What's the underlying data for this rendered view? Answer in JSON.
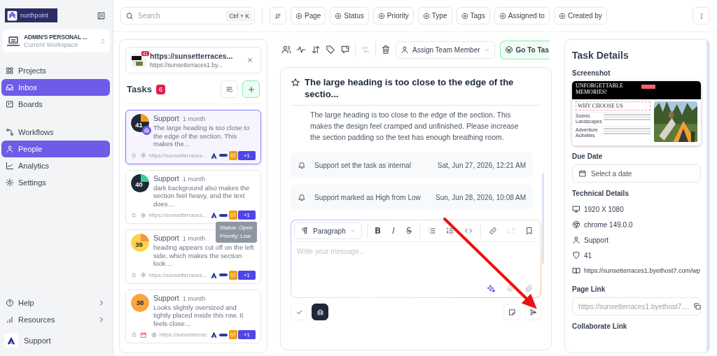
{
  "sidebar": {
    "logo_text": "northpoint",
    "workspace": {
      "name": "ADMIN'S PERSONAL ...",
      "subtitle": "Current Workspace"
    },
    "nav": [
      {
        "items": [
          {
            "label": "Projects",
            "selected": false
          },
          {
            "label": "Inbox",
            "selected": true
          },
          {
            "label": "Boards",
            "selected": false
          }
        ]
      },
      {
        "items": [
          {
            "label": "Workflows",
            "selected": false
          },
          {
            "label": "People",
            "selected": true
          },
          {
            "label": "Analytics",
            "selected": false
          },
          {
            "label": "Settings",
            "selected": false
          }
        ]
      }
    ],
    "footer_links": [
      "Help",
      "Resources"
    ],
    "user": "Support"
  },
  "topbar": {
    "search": {
      "placeholder": "Search",
      "shortcut": "Ctrl + K"
    },
    "filters": [
      "Page",
      "Status",
      "Priority",
      "Type",
      "Tags",
      "Assigned to",
      "Created by"
    ]
  },
  "tasks_panel": {
    "site": {
      "badge": "41",
      "title": "https://sunsetterraces...",
      "url": "https://sunsetterraces1.by..."
    },
    "title": "Tasks",
    "count": "6",
    "tasks": [
      {
        "author": "Support",
        "age": "1 month",
        "number": "41",
        "color": "#1f2937",
        "ring": {
          "color": "#f59e0b"
        },
        "internal": true,
        "has_due_date": false,
        "selected": true,
        "description": "The large heading is too close to the edge of the section. This makes the…",
        "url": "https://sunsetterraces...",
        "avatars": [
          "ST",
          "+1"
        ]
      },
      {
        "author": "Support",
        "age": "1 month",
        "number": "40",
        "color": "#1f2937",
        "ring": {
          "color": "#34d399"
        },
        "internal": false,
        "has_due_date": false,
        "selected": false,
        "description": "dark background also makes the section feel heavy, and the text does…",
        "url": "https://sunsetterraces...",
        "avatars": [
          "ST",
          "+1"
        ]
      },
      {
        "author": "Support",
        "age": "1 month",
        "number": "39",
        "color": "#fcd34d",
        "ring": {
          "color": "#fb923c"
        },
        "internal": false,
        "has_due_date": false,
        "selected": false,
        "description": "heading appears cut off on the left side, which makes the section look…",
        "url": "https://sunsetterraces...",
        "avatars": [
          "ST",
          "+1"
        ],
        "tooltip": [
          "Status: Open",
          "Priority: Low"
        ]
      },
      {
        "author": "Support",
        "age": "1 month",
        "number": "38",
        "color": "#fba43c",
        "internal": false,
        "has_due_date": true,
        "selected": false,
        "description": "Looks slightly oversized and tightly placed inside this row. It feels close…",
        "url": "https://sunsetterrac",
        "avatars": [
          "ST",
          "+1"
        ]
      }
    ]
  },
  "detail": {
    "actions": [
      {
        "disabled": false
      },
      {
        "disabled": false
      },
      {
        "disabled": false
      },
      {
        "disabled": false
      },
      {
        "disabled": false
      },
      {
        "disabled": true
      },
      {
        "disabled": false
      }
    ],
    "assign_label": "Assign Team Member",
    "goto_label": "Go To Tas",
    "title": "The large heading is too close to the edge of the sectio...",
    "body": "The large heading is too close to the edge of the section. This makes the design feel cramped and unfinished. Please increase the section padding so the text has enough breathing room.",
    "activity": [
      {
        "text": "Support set the task as internal",
        "date": "Sat, Jun 27, 2026, 12:21 AM"
      },
      {
        "text": "Support marked as High from Low",
        "date": "Sun, Jun 28, 2026, 10:08 AM"
      }
    ],
    "editor": {
      "format": "Paragraph",
      "format_buttons": [
        "B",
        "I",
        "S"
      ],
      "tools": [
        {
          "disabled": false
        },
        {
          "disabled": false
        },
        {
          "disabled": false
        },
        {
          "disabled": false
        },
        {
          "disabled": true
        },
        {
          "disabled": false
        }
      ],
      "placeholder": "Write your message..."
    }
  },
  "details_panel": {
    "title": "Task Details",
    "screenshot_label": "Screenshot",
    "screenshot": {
      "hero": "UNFORGETTABLE MEMORIES!",
      "section": "WHY CHOOSE US",
      "rows": [
        "Scenic Landscapes",
        "Adventure Activities"
      ]
    },
    "due_date_label": "Due Date",
    "due_date_placeholder": "Select a date",
    "technical_label": "Technical Details",
    "technical": [
      "1920 X 1080",
      "chrome 149.0.0",
      "Support",
      "41",
      "https://sunsetterraces1.byethost7.com/wp"
    ],
    "page_link_label": "Page Link",
    "page_link": "https://sunsetterraces1.byethost7....",
    "collab_label": "Collaborate Link"
  }
}
